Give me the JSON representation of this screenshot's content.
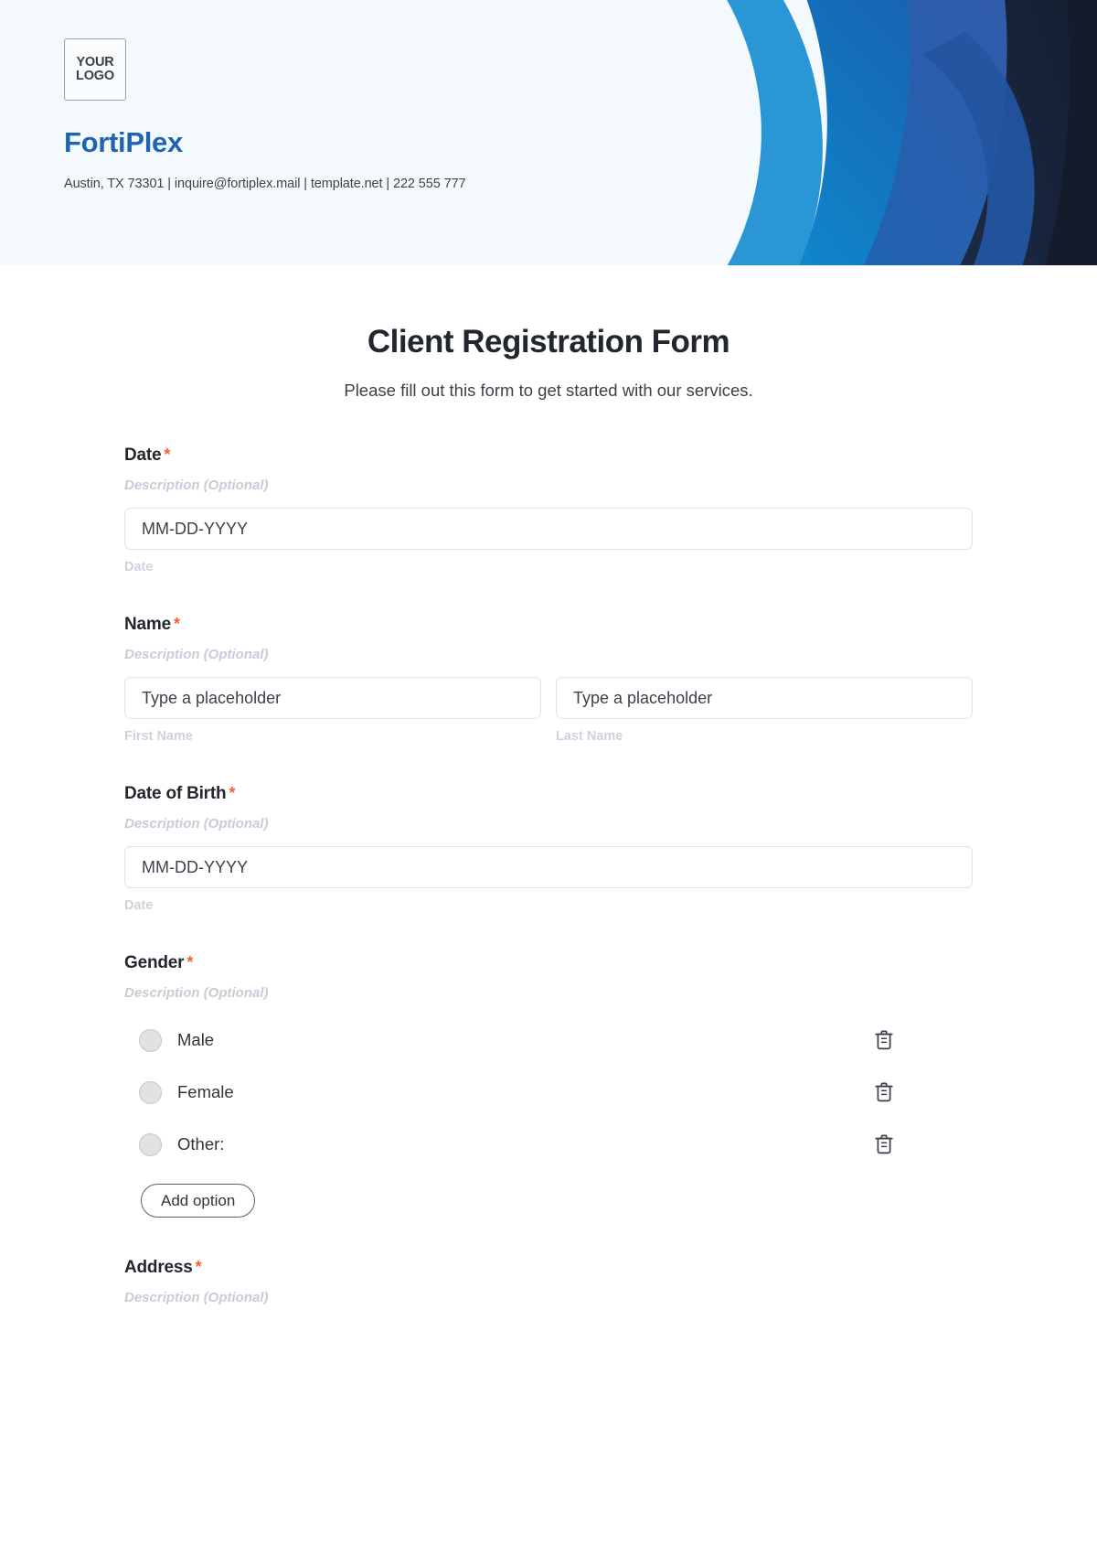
{
  "header": {
    "logo": {
      "line1": "YOUR",
      "line2": "LOGO"
    },
    "brand_name": "FortiPlex",
    "contact": "Austin, TX 73301 | inquire@fortiplex.mail | template.net | 222 555 777",
    "colors": {
      "background": "#f4f9fd",
      "brand_blue": "#1f63b5",
      "art_light_blue": "#2a96d6",
      "art_mid_blue": "#1470b8",
      "art_indigo": "#2f4f96",
      "art_navy": "#1b2740",
      "art_dark": "#141c2b"
    }
  },
  "form": {
    "title": "Client Registration Form",
    "subtitle": "Please fill out this form to get started with our services.",
    "required_marker": "*",
    "description_placeholder": "Description (Optional)",
    "accent_required_color": "#f4603c",
    "fields": [
      {
        "label": "Date",
        "description": "Description (Optional)",
        "type": "date",
        "placeholder": "MM-DD-YYYY",
        "caption": "Date",
        "required": true
      },
      {
        "label": "Name",
        "description": "Description (Optional)",
        "type": "name-pair",
        "required": true,
        "sub_fields": [
          {
            "placeholder": "Type a placeholder",
            "caption": "First Name"
          },
          {
            "placeholder": "Type a placeholder",
            "caption": "Last Name"
          }
        ]
      },
      {
        "label": "Date of Birth",
        "description": "Description (Optional)",
        "type": "date",
        "placeholder": "MM-DD-YYYY",
        "caption": "Date",
        "required": true
      },
      {
        "label": "Gender",
        "description": "Description (Optional)",
        "type": "radio-group",
        "required": true,
        "options": [
          {
            "label": "Male",
            "delete_icon": "trash-icon"
          },
          {
            "label": "Female",
            "delete_icon": "trash-icon"
          },
          {
            "label": "Other:",
            "delete_icon": "trash-icon"
          }
        ],
        "add_option_label": "Add option"
      },
      {
        "label": "Address",
        "description": "Description (Optional)",
        "type": "text",
        "required": true
      }
    ]
  }
}
